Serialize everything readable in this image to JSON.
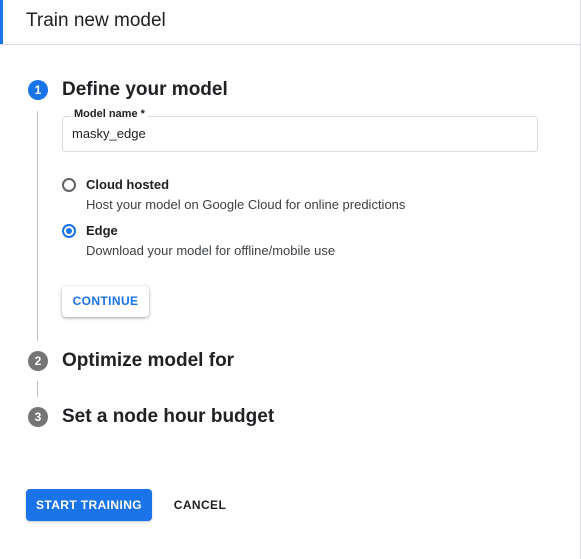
{
  "header": {
    "title": "Train new model"
  },
  "steps": [
    {
      "number": "1",
      "title": "Define your model",
      "state": "active"
    },
    {
      "number": "2",
      "title": "Optimize model for",
      "state": "inactive"
    },
    {
      "number": "3",
      "title": "Set a node hour budget",
      "state": "inactive"
    }
  ],
  "model_name": {
    "label": "Model name *",
    "value": "masky_edge"
  },
  "hosting_options": [
    {
      "label": "Cloud hosted",
      "description": "Host your model on Google Cloud for online predictions",
      "selected": false
    },
    {
      "label": "Edge",
      "description": "Download your model for offline/mobile use",
      "selected": true
    }
  ],
  "buttons": {
    "continue_label": "CONTINUE",
    "start_training_label": "START TRAINING",
    "cancel_label": "CANCEL"
  },
  "colors": {
    "accent": "#1a73e8",
    "inactive_step": "#757575"
  }
}
